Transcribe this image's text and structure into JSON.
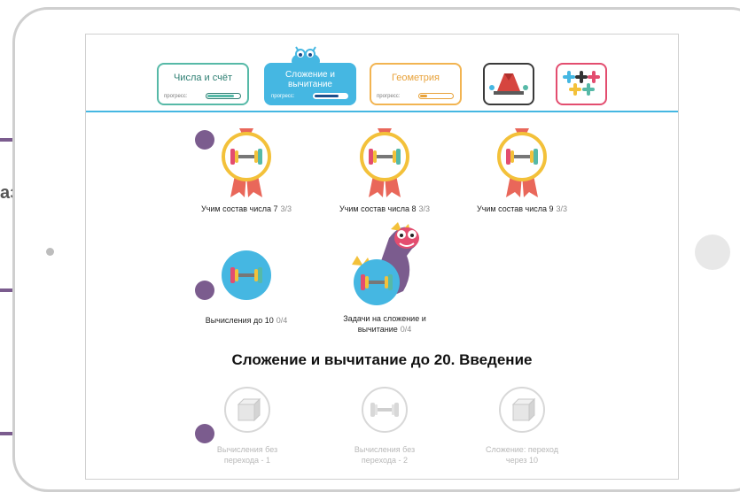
{
  "side_caption": "азвития",
  "tabs": [
    {
      "title": "Числа и счёт",
      "progress_label": "прогресс:",
      "progress": 0.85
    },
    {
      "title": "Сложение и вычитание",
      "progress_label": "прогресс:",
      "progress": 0.75
    },
    {
      "title": "Геометрия",
      "progress_label": "прогресс:",
      "progress": 0.25
    }
  ],
  "icon_tabs": [
    {
      "icon": "gem-blocks-icon"
    },
    {
      "icon": "color-plus-icon"
    }
  ],
  "lessons_completed": [
    {
      "label": "Учим состав числа 7",
      "count": "3/3"
    },
    {
      "label": "Учим состав числа 8",
      "count": "3/3"
    },
    {
      "label": "Учим состав числа 9",
      "count": "3/3"
    }
  ],
  "lessons_current": [
    {
      "label": "Вычисления до 10",
      "count": "0/4"
    },
    {
      "label_line1": "Задачи на сложение и",
      "label_line2": "вычитание",
      "count": "0/4"
    }
  ],
  "section_title": "Сложение и вычитание до 20. Введение",
  "lessons_locked": [
    {
      "line1": "Вычисления без",
      "line2": "перехода - 1"
    },
    {
      "line1": "Вычисления без",
      "line2": "перехода - 2"
    },
    {
      "line1": "Сложение: переход",
      "line2": "через 10"
    }
  ],
  "colors": {
    "accent_blue": "#45b7e2",
    "teal": "#56b9a7",
    "orange": "#f2b451",
    "pink": "#e34d6f",
    "connector": "#7b5c8e",
    "medal_gold": "#f3c13a",
    "medal_ribbon": "#e9675a"
  }
}
